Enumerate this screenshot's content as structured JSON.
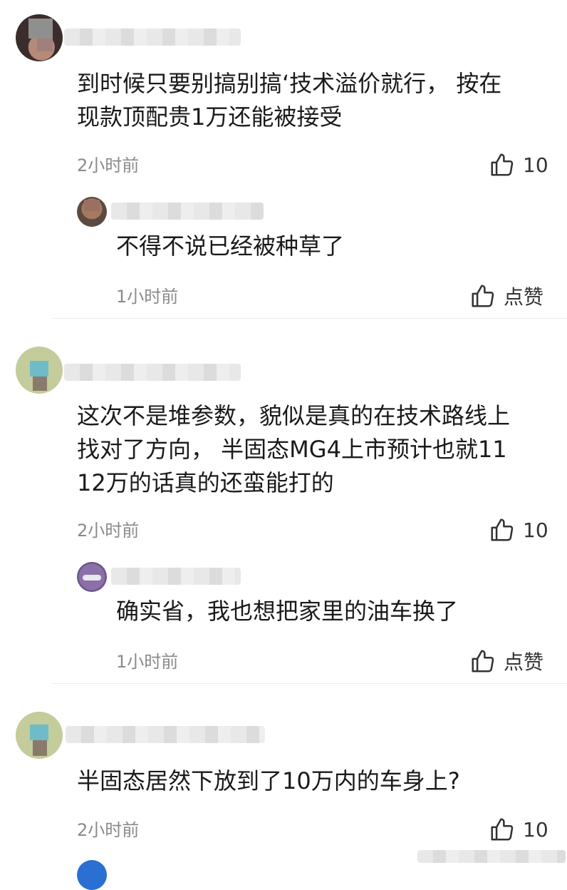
{
  "comments": [
    {
      "text_lines": [
        "到时候只要别搞别搞‘技术溢价就行， 按在",
        "现款顶配贵1万还能被接受"
      ],
      "time": "2小时前",
      "likes": "10",
      "reply": {
        "text_lines": [
          "不得不说已经被种草了"
        ],
        "time": "1小时前",
        "likes": "点赞"
      }
    },
    {
      "text_lines": [
        "这次不是堆参数，貌似是真的在技术路线上",
        "找对了方向， 半固态MG4上市预计也就11",
        "12万的话真的还蛮能打的"
      ],
      "time": "2小时前",
      "likes": "10",
      "reply": {
        "text_lines": [
          "确实省，我也想把家里的油车换了"
        ],
        "time": "1小时前",
        "likes": "点赞"
      }
    },
    {
      "text_lines": [
        "半固态居然下放到了10万内的车身上?"
      ],
      "time": "2小时前",
      "likes": "10"
    }
  ],
  "icons": {
    "like": "thumbs-up-icon",
    "avatar_placeholder": "blurred-avatar"
  },
  "colors": {
    "text": "#1a1a1a",
    "muted": "#8a8a8a",
    "divider": "#ececec"
  }
}
